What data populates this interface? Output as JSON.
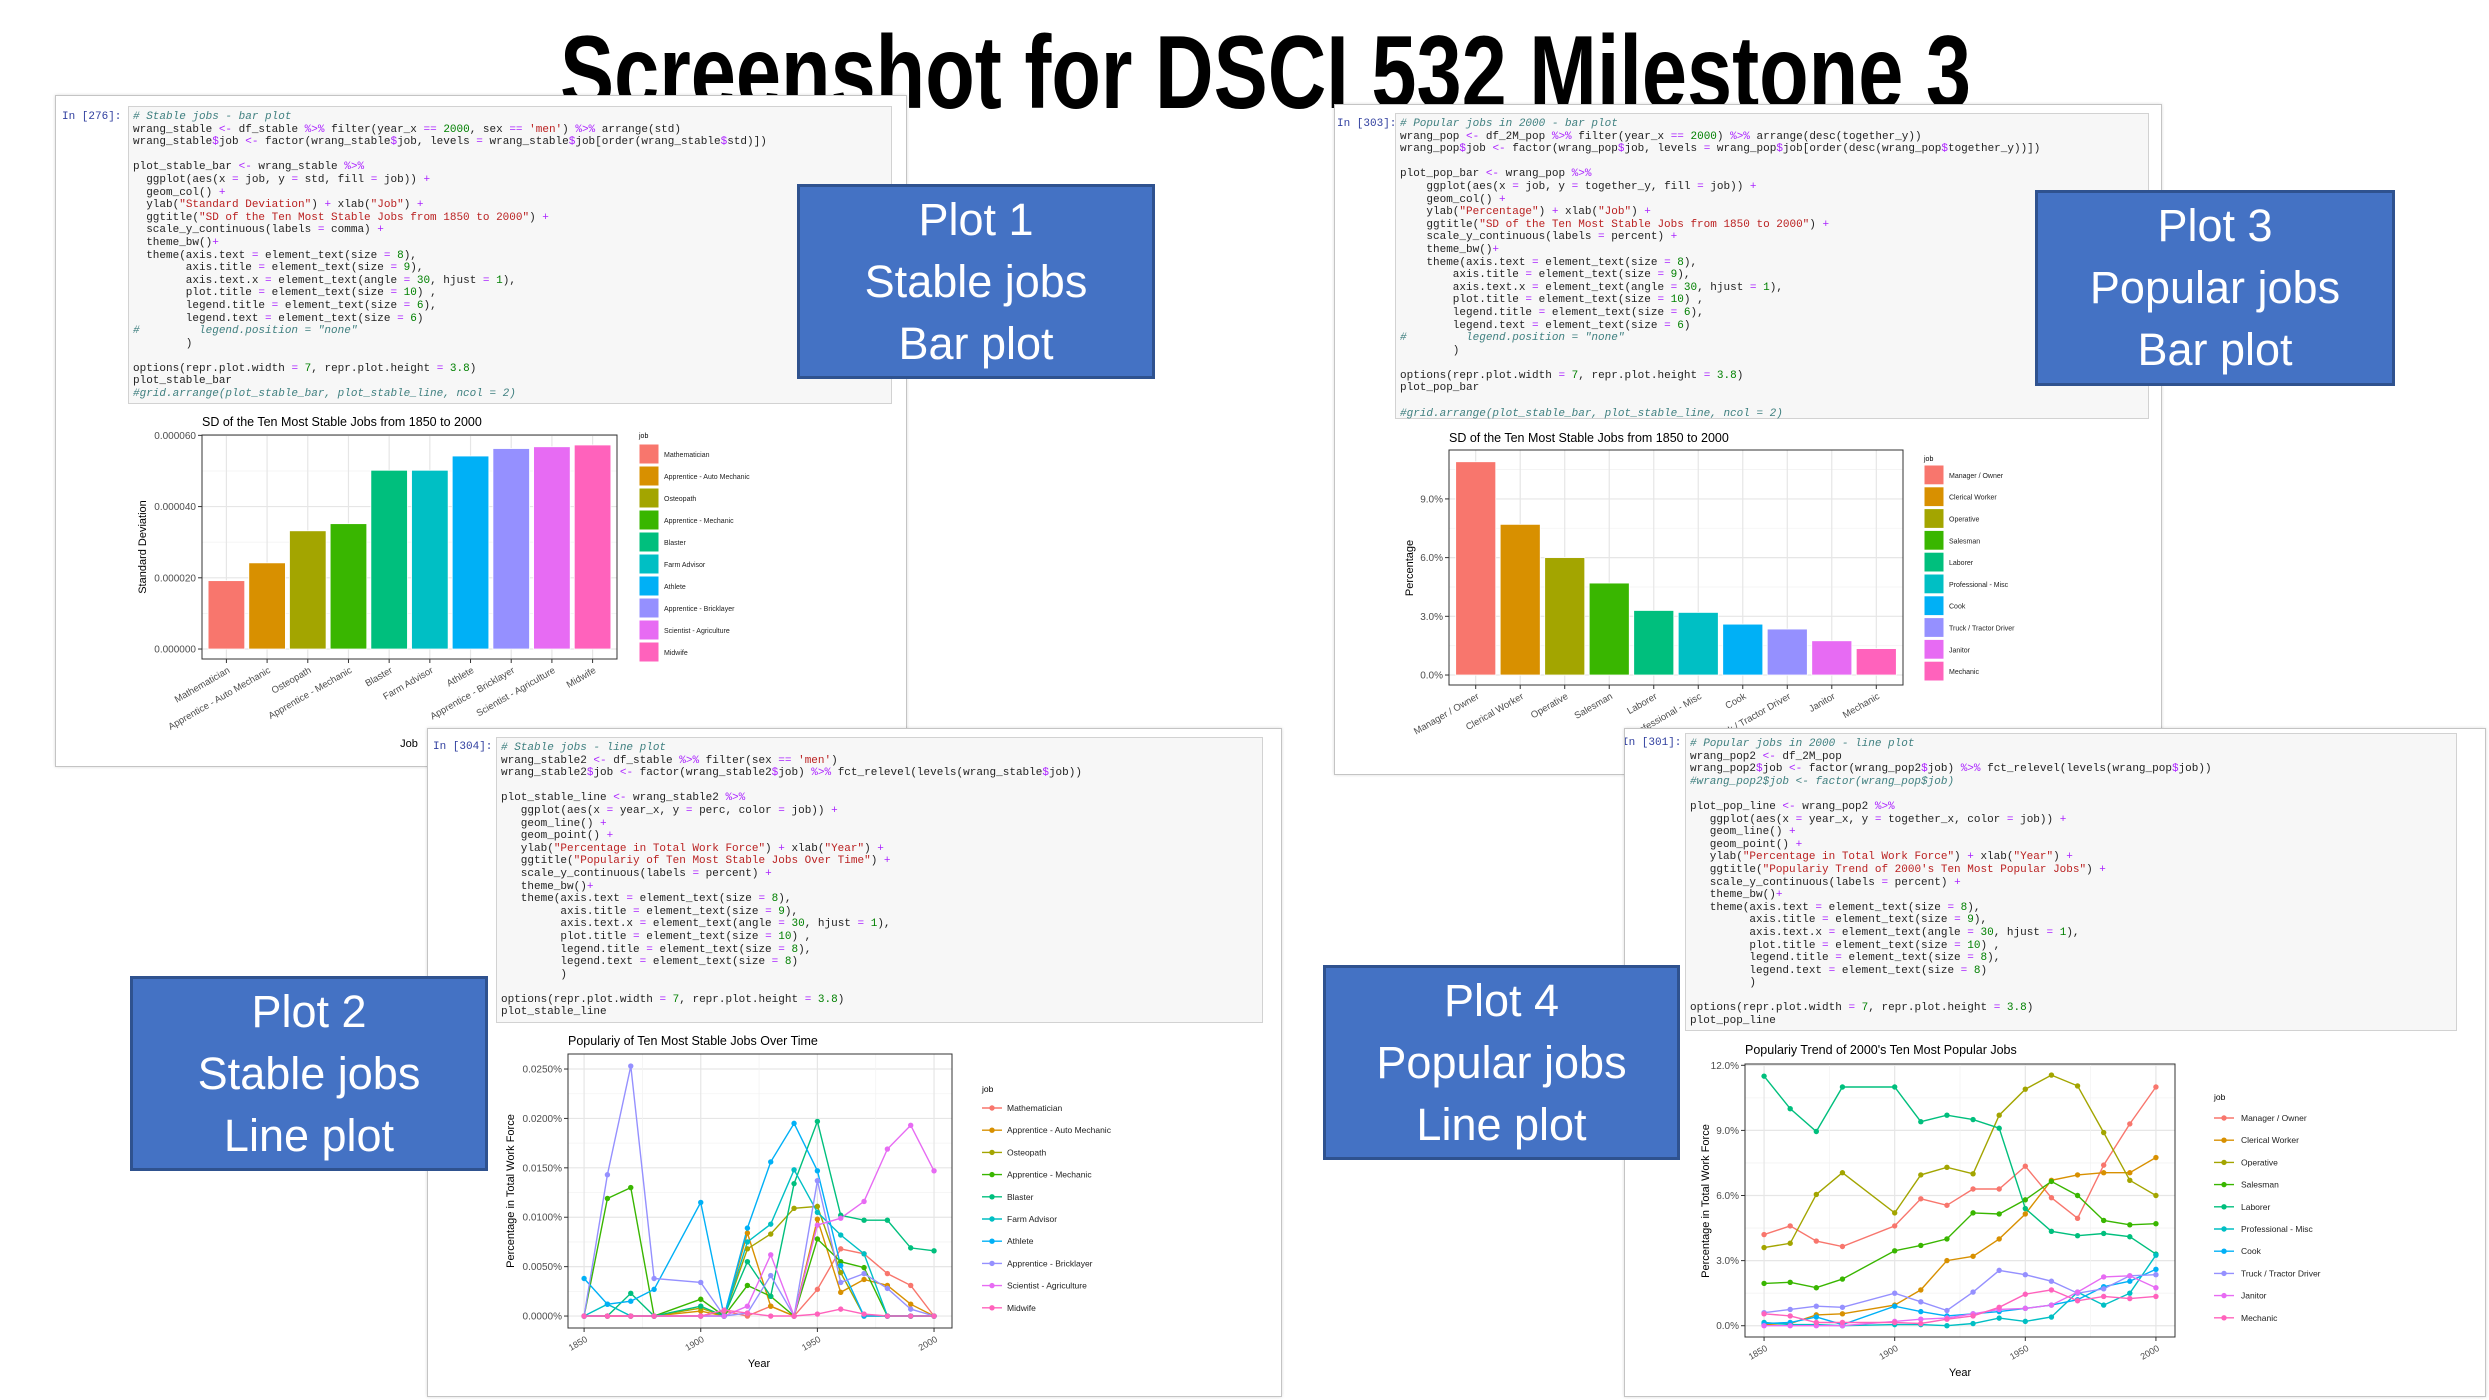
{
  "title": "Screenshot for DSCI 532 Milestone 3",
  "labels": [
    {
      "line1": "Plot 1",
      "line2": "Stable jobs",
      "line3": "Bar plot"
    },
    {
      "line1": "Plot 2",
      "line2": "Stable jobs",
      "line3": "Line plot"
    },
    {
      "line1": "Plot 3",
      "line2": "Popular jobs",
      "line3": "Bar plot"
    },
    {
      "line1": "Plot 4",
      "line2": "Popular jobs",
      "line3": "Line plot"
    }
  ],
  "cells": [
    {
      "prompt": "In [276]:",
      "code": [
        "# Stable jobs - bar plot",
        "wrang_stable <- df_stable %>% filter(year_x == 2000, sex == 'men') %>% arrange(std)",
        "wrang_stable$job <- factor(wrang_stable$job, levels = wrang_stable$job[order(wrang_stable$std)])",
        "",
        "plot_stable_bar <- wrang_stable %>%",
        "  ggplot(aes(x = job, y = std, fill = job)) +",
        "  geom_col() +",
        "  ylab(\"Standard Deviation\") + xlab(\"Job\") +",
        "  ggtitle(\"SD of the Ten Most Stable Jobs from 1850 to 2000\") +",
        "  scale_y_continuous(labels = comma) +",
        "  theme_bw()+",
        "  theme(axis.text = element_text(size = 8),",
        "        axis.title = element_text(size = 9),",
        "        axis.text.x = element_text(angle = 30, hjust = 1),",
        "        plot.title = element_text(size = 10) ,",
        "        legend.title = element_text(size = 6),",
        "        legend.text = element_text(size = 6)",
        "#         legend.position = \"none\"",
        "        )",
        "",
        "options(repr.plot.width = 7, repr.plot.height = 3.8)",
        "plot_stable_bar",
        "#grid.arrange(plot_stable_bar, plot_stable_line, ncol = 2)"
      ]
    },
    {
      "prompt": "In [304]:",
      "code": [
        "# Stable jobs - line plot",
        "wrang_stable2 <- df_stable %>% filter(sex == 'men')",
        "wrang_stable2$job <- factor(wrang_stable2$job) %>% fct_relevel(levels(wrang_stable$job))",
        "",
        "plot_stable_line <- wrang_stable2 %>%",
        "   ggplot(aes(x = year_x, y = perc, color = job)) +",
        "   geom_line() +",
        "   geom_point() +",
        "   ylab(\"Percentage in Total Work Force\") + xlab(\"Year\") +",
        "   ggtitle(\"Populariy of Ten Most Stable Jobs Over Time\") +",
        "   scale_y_continuous(labels = percent) +",
        "   theme_bw()+",
        "   theme(axis.text = element_text(size = 8),",
        "         axis.title = element_text(size = 9),",
        "         axis.text.x = element_text(angle = 30, hjust = 1),",
        "         plot.title = element_text(size = 10) ,",
        "         legend.title = element_text(size = 8),",
        "         legend.text = element_text(size = 8)",
        "         )",
        "",
        "options(repr.plot.width = 7, repr.plot.height = 3.8)",
        "plot_stable_line"
      ]
    },
    {
      "prompt": "In [303]:",
      "code": [
        "# Popular jobs in 2000 - bar plot",
        "wrang_pop <- df_2M_pop %>% filter(year_x == 2000) %>% arrange(desc(together_y))",
        "wrang_pop$job <- factor(wrang_pop$job, levels = wrang_pop$job[order(desc(wrang_pop$together_y))])",
        "",
        "plot_pop_bar <- wrang_pop %>%",
        "    ggplot(aes(x = job, y = together_y, fill = job)) +",
        "    geom_col() +",
        "    ylab(\"Percentage\") + xlab(\"Job\") +",
        "    ggtitle(\"SD of the Ten Most Stable Jobs from 1850 to 2000\") +",
        "    scale_y_continuous(labels = percent) +",
        "    theme_bw()+",
        "    theme(axis.text = element_text(size = 8),",
        "        axis.title = element_text(size = 9),",
        "        axis.text.x = element_text(angle = 30, hjust = 1),",
        "        plot.title = element_text(size = 10) ,",
        "        legend.title = element_text(size = 6),",
        "        legend.text = element_text(size = 6)",
        "#         legend.position = \"none\"",
        "        )",
        "",
        "options(repr.plot.width = 7, repr.plot.height = 3.8)",
        "plot_pop_bar",
        "",
        "#grid.arrange(plot_stable_bar, plot_stable_line, ncol = 2)"
      ]
    },
    {
      "prompt": "In [301]:",
      "code": [
        "# Popular jobs in 2000 - line plot",
        "wrang_pop2 <- df_2M_pop",
        "wrang_pop2$job <- factor(wrang_pop2$job) %>% fct_relevel(levels(wrang_pop$job))",
        "#wrang_pop2$job <- factor(wrang_pop$job)",
        "",
        "plot_pop_line <- wrang_pop2 %>%",
        "   ggplot(aes(x = year_x, y = together_x, color = job)) +",
        "   geom_line() +",
        "   geom_point() +",
        "   ylab(\"Percentage in Total Work Force\") + xlab(\"Year\") +",
        "   ggtitle(\"Populariy Trend of 2000's Ten Most Popular Jobs\") +",
        "   scale_y_continuous(labels = percent) +",
        "   theme_bw()+",
        "   theme(axis.text = element_text(size = 8),",
        "         axis.title = element_text(size = 9),",
        "         axis.text.x = element_text(angle = 30, hjust = 1),",
        "         plot.title = element_text(size = 10) ,",
        "         legend.title = element_text(size = 8),",
        "         legend.text = element_text(size = 8)",
        "         )",
        "",
        "options(repr.plot.width = 7, repr.plot.height = 3.8)",
        "plot_pop_line"
      ]
    }
  ],
  "chart_data": [
    {
      "type": "bar",
      "title": "SD of the Ten Most Stable Jobs from 1850 to 2000",
      "xlabel": "Job",
      "ylabel": "Standard Deviation",
      "legend_title": "job",
      "legend_position": "right",
      "grid": true,
      "categories": [
        "Mathematician",
        "Apprentice - Auto Mechanic",
        "Osteopath",
        "Apprentice - Mechanic",
        "Blaster",
        "Farm Advisor",
        "Athlete",
        "Apprentice - Bricklayer",
        "Scientist - Agriculture",
        "Midwife"
      ],
      "values": [
        1.92e-05,
        2.42e-05,
        3.32e-05,
        3.52e-05,
        5.02e-05,
        5.02e-05,
        5.42e-05,
        5.63e-05,
        5.68e-05,
        5.73e-05
      ],
      "colors": [
        "#F8766D",
        "#D89000",
        "#A3A500",
        "#39B600",
        "#00BF7D",
        "#00BFC4",
        "#00B0F6",
        "#9590FF",
        "#E76BF3",
        "#FF62BC"
      ],
      "ylim": [
        -2.8e-06,
        6.01e-05
      ],
      "yticks": [
        0,
        2e-05,
        4e-05,
        6e-05
      ],
      "ytick_labels": [
        "0.000000",
        "0.000020",
        "0.000040",
        "0.000060"
      ]
    },
    {
      "type": "line",
      "title": "Populariy of Ten Most Stable Jobs Over Time",
      "xlabel": "Year",
      "ylabel": "Percentage in Total Work Force",
      "legend_title": "job",
      "legend_position": "right",
      "grid": true,
      "x": [
        1850,
        1860,
        1870,
        1880,
        1900,
        1910,
        1920,
        1930,
        1940,
        1950,
        1960,
        1970,
        1980,
        1990,
        2000
      ],
      "xlim": [
        1843.1,
        2007.7
      ],
      "xticks": [
        1850,
        1900,
        1950,
        2000
      ],
      "xtick_labels": [
        "1850",
        "1900",
        "1950",
        "2000"
      ],
      "ylim": [
        -0.00121,
        0.02652
      ],
      "yticks": [
        0,
        0.005,
        0.01,
        0.015,
        0.02,
        0.025
      ],
      "ytick_labels": [
        "0.0000%",
        "0.0050%",
        "0.0100%",
        "0.0150%",
        "0.0200%",
        "0.0250%"
      ],
      "series": [
        {
          "name": "Mathematician",
          "color": "#F8766D",
          "values": [
            0,
            0,
            0,
            0,
            0,
            0.0005,
            0,
            0.001,
            0,
            0.0027,
            0.0068,
            0.0063,
            0.0043,
            0.0031,
            0
          ]
        },
        {
          "name": "Apprentice - Auto Mechanic",
          "color": "#D89000",
          "values": [
            0,
            0,
            0,
            0,
            0.0005,
            0,
            0.0084,
            0.001,
            0,
            0.0098,
            0.0024,
            0.0037,
            0.0031,
            0.0012,
            0
          ]
        },
        {
          "name": "Osteopath",
          "color": "#A3A500",
          "values": [
            0,
            0,
            0,
            0,
            0.0008,
            0,
            0.0068,
            0.0083,
            0.0109,
            0.0111,
            0.0044,
            0,
            0,
            0,
            0
          ]
        },
        {
          "name": "Apprentice - Mechanic",
          "color": "#39B600",
          "values": [
            0,
            0.0119,
            0.013,
            0,
            0.0017,
            0,
            0.0031,
            0.002,
            0,
            0.0078,
            0.0055,
            0.0049,
            0,
            0,
            0
          ]
        },
        {
          "name": "Blaster",
          "color": "#00BF7D",
          "values": [
            0,
            0,
            0.0023,
            0,
            0.001,
            0,
            0.0055,
            0.002,
            0.0134,
            0.0197,
            0.0102,
            0.0097,
            0.0097,
            0.0069,
            0.0066
          ]
        },
        {
          "name": "Farm Advisor",
          "color": "#00BFC4",
          "values": [
            0,
            0.0012,
            0,
            0,
            0,
            0,
            0.0075,
            0.0093,
            0.0148,
            0.0105,
            0.0082,
            0.0063,
            0,
            0,
            0
          ]
        },
        {
          "name": "Athlete",
          "color": "#00B0F6",
          "values": [
            0.0038,
            0.0012,
            0.0015,
            0.0027,
            0.0115,
            0,
            0.0089,
            0.0156,
            0.0195,
            0.0147,
            0.0051,
            0,
            0,
            0,
            0
          ]
        },
        {
          "name": "Apprentice - Bricklayer",
          "color": "#9590FF",
          "values": [
            0,
            0.0143,
            0.0253,
            0.0038,
            0.0034,
            0,
            0.0003,
            0.0041,
            0,
            0.0137,
            0.0034,
            0.0043,
            0.0028,
            0.0007,
            0
          ]
        },
        {
          "name": "Scientist - Agriculture",
          "color": "#E76BF3",
          "values": [
            0,
            0,
            0,
            0,
            0,
            0,
            0.001,
            0.0062,
            0,
            0.0092,
            0.0099,
            0.0116,
            0.0169,
            0.0193,
            0.0147
          ]
        },
        {
          "name": "Midwife",
          "color": "#FF62BC",
          "values": [
            0,
            0,
            0,
            0,
            0,
            0.0006,
            0.0003,
            0,
            0,
            0.0002,
            0.0007,
            0.0002,
            0,
            0,
            0
          ]
        }
      ]
    },
    {
      "type": "bar",
      "title": "SD of the Ten Most Stable Jobs from 1850 to 2000",
      "ylabel": "Percentage",
      "legend_title": "job",
      "legend_position": "right",
      "grid": true,
      "categories": [
        "Manager / Owner",
        "Clerical Worker",
        "Operative",
        "Salesman",
        "Laborer",
        "Professional - Misc",
        "Cook",
        "Truck / Tractor Driver",
        "Janitor",
        "Mechanic"
      ],
      "values": [
        10.9,
        7.7,
        6.0,
        4.7,
        3.3,
        3.2,
        2.6,
        2.35,
        1.75,
        1.35
      ],
      "colors": [
        "#F8766D",
        "#D89000",
        "#A3A500",
        "#39B600",
        "#00BF7D",
        "#00BFC4",
        "#00B0F6",
        "#9590FF",
        "#E76BF3",
        "#FF62BC"
      ],
      "ylim": [
        -0.51,
        11.5
      ],
      "yticks": [
        0,
        3,
        6,
        9
      ],
      "ytick_labels": [
        "0.0%",
        "3.0%",
        "6.0%",
        "9.0%"
      ]
    },
    {
      "type": "line",
      "title": "Populariy Trend of 2000's Ten Most Popular Jobs",
      "xlabel": "Year",
      "ylabel": "Percentage in Total Work Force",
      "legend_title": "job",
      "legend_position": "right",
      "grid": true,
      "x": [
        1850,
        1860,
        1870,
        1880,
        1900,
        1910,
        1920,
        1930,
        1940,
        1950,
        1960,
        1970,
        1980,
        1990,
        2000
      ],
      "xlim": [
        1842.7,
        2007.3
      ],
      "xticks": [
        1850,
        1900,
        1950,
        2000
      ],
      "xtick_labels": [
        "1850",
        "1900",
        "1950",
        "2000"
      ],
      "ylim": [
        -0.52,
        12.06
      ],
      "yticks": [
        0,
        3,
        6,
        9,
        12
      ],
      "ytick_labels": [
        "0.0%",
        "3.0%",
        "6.0%",
        "9.0%",
        "12.0%"
      ],
      "series": [
        {
          "name": "Manager / Owner",
          "color": "#F8766D",
          "values": [
            4.2,
            4.6,
            3.9,
            3.65,
            4.6,
            5.85,
            5.55,
            6.3,
            6.3,
            7.35,
            5.9,
            4.95,
            7.4,
            9.3,
            11.0
          ]
        },
        {
          "name": "Clerical Worker",
          "color": "#D89000",
          "values": [
            0.05,
            0.1,
            0.5,
            0.55,
            0.95,
            1.65,
            3.0,
            3.2,
            4.0,
            5.15,
            6.7,
            6.95,
            7.05,
            7.05,
            7.75
          ]
        },
        {
          "name": "Operative",
          "color": "#A3A500",
          "values": [
            3.6,
            3.8,
            6.05,
            7.05,
            5.2,
            6.95,
            7.3,
            7.0,
            9.7,
            10.9,
            11.55,
            11.05,
            8.9,
            6.7,
            6.0
          ]
        },
        {
          "name": "Salesman",
          "color": "#39B600",
          "values": [
            1.95,
            2.0,
            1.75,
            2.15,
            3.45,
            3.7,
            4.0,
            5.2,
            5.15,
            5.8,
            6.65,
            6.0,
            4.85,
            4.65,
            4.7
          ]
        },
        {
          "name": "Laborer",
          "color": "#00BF7D",
          "values": [
            11.5,
            10.0,
            8.95,
            11.0,
            11.0,
            9.4,
            9.7,
            9.5,
            9.1,
            5.4,
            4.35,
            4.15,
            4.25,
            4.1,
            3.3
          ]
        },
        {
          "name": "Professional - Misc",
          "color": "#00BFC4",
          "values": [
            0.15,
            0.05,
            0.05,
            0.0,
            0.05,
            0.05,
            0.0,
            0.1,
            0.35,
            0.2,
            0.4,
            1.55,
            0.95,
            1.5,
            3.25
          ]
        },
        {
          "name": "Cook",
          "color": "#00B0F6",
          "values": [
            0.1,
            0.15,
            0.4,
            0.05,
            0.9,
            0.65,
            0.45,
            0.55,
            0.65,
            0.8,
            0.95,
            1.2,
            1.8,
            2.05,
            2.6
          ]
        },
        {
          "name": "Truck / Tractor Driver",
          "color": "#9590FF",
          "values": [
            0.6,
            0.75,
            0.9,
            0.85,
            1.5,
            1.1,
            0.7,
            1.55,
            2.55,
            2.35,
            2.05,
            1.5,
            1.7,
            2.3,
            2.35
          ]
        },
        {
          "name": "Janitor",
          "color": "#E76BF3",
          "values": [
            0,
            0,
            0,
            0,
            0.2,
            0.3,
            0.35,
            0.55,
            0.75,
            0.8,
            0.95,
            1.55,
            2.25,
            2.3,
            1.75
          ]
        },
        {
          "name": "Mechanic",
          "color": "#FF62BC",
          "values": [
            0.55,
            0.45,
            0.15,
            0.15,
            0.15,
            0.1,
            0.3,
            0.45,
            0.85,
            1.45,
            1.65,
            1.15,
            1.35,
            1.25,
            1.35
          ]
        }
      ]
    }
  ]
}
